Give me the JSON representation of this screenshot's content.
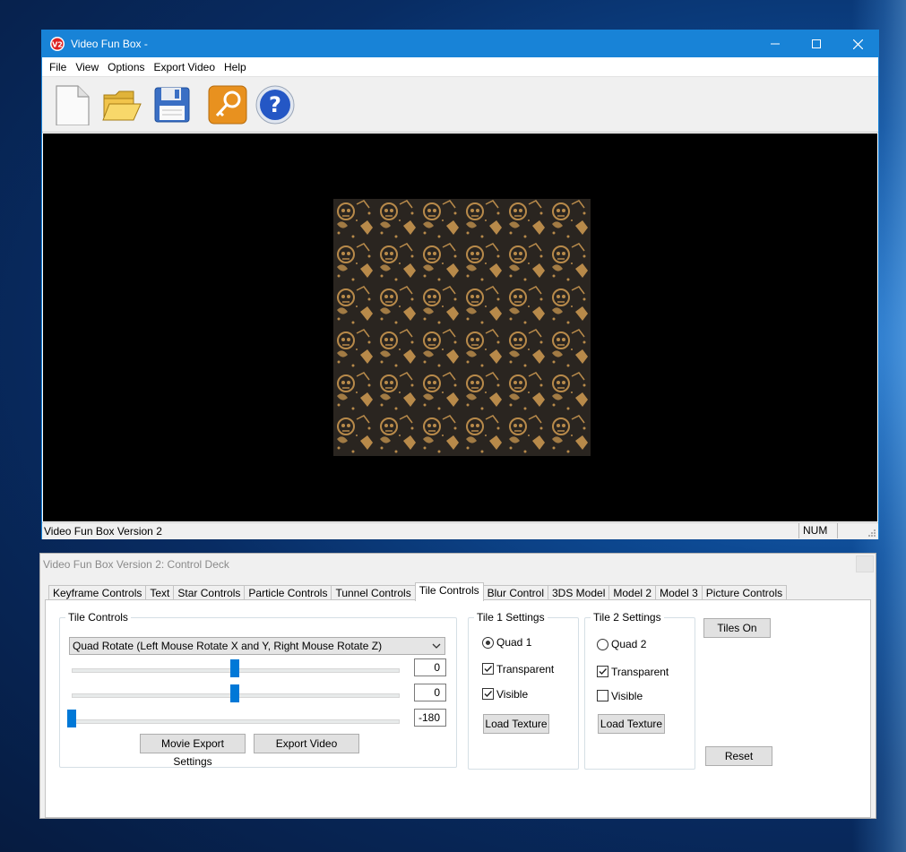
{
  "window": {
    "title": "Video Fun Box -",
    "menu": [
      "File",
      "View",
      "Options",
      "Export Video",
      "Help"
    ],
    "toolbar_icons": [
      "new-file-icon",
      "open-folder-icon",
      "save-disk-icon",
      "key-icon",
      "help-icon"
    ],
    "status_text": "Video Fun Box Version 2",
    "status_num": "NUM"
  },
  "deck": {
    "title": "Video Fun Box Version 2: Control Deck",
    "tabs": [
      "Keyframe Controls",
      "Text",
      "Star Controls",
      "Particle Controls",
      "Tunnel Controls",
      "Tile Controls",
      "Blur Control",
      "3DS Model",
      "Model 2",
      "Model 3",
      "Picture Controls"
    ],
    "active_tab": "Tile Controls",
    "tile_controls": {
      "group_label": "Tile Controls",
      "mode_selected": "Quad Rotate (Left Mouse Rotate X and Y, Right Mouse Rotate Z)",
      "slider_values": [
        "0",
        "0",
        "-180"
      ],
      "movie_export_label": "Movie Export Settings",
      "export_video_label": "Export Video"
    },
    "tile1": {
      "group_label": "Tile 1 Settings",
      "radio_label": "Quad 1",
      "radio_checked": true,
      "transparent_label": "Transparent",
      "transparent_checked": true,
      "visible_label": "Visible",
      "visible_checked": true,
      "load_label": "Load Texture"
    },
    "tile2": {
      "group_label": "Tile 2 Settings",
      "radio_label": "Quad 2",
      "radio_checked": false,
      "transparent_label": "Transparent",
      "transparent_checked": true,
      "visible_label": "Visible",
      "visible_checked": false,
      "load_label": "Load Texture"
    },
    "tiles_on_label": "Tiles On",
    "reset_label": "Reset"
  },
  "colors": {
    "titlebar": "#1883d7",
    "slider_thumb": "#0078d7",
    "texture_bg": "#2a2520",
    "texture_pattern": "#b88a4a"
  }
}
